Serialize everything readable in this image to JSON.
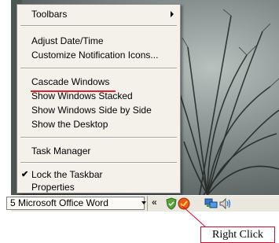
{
  "context_menu": {
    "items": [
      {
        "label": "Toolbars"
      },
      {
        "label": "Adjust Date/Time"
      },
      {
        "label": "Customize Notification Icons..."
      },
      {
        "label": "Cascade Windows"
      },
      {
        "label": "Show Windows Stacked"
      },
      {
        "label": "Show Windows Side by Side"
      },
      {
        "label": "Show the Desktop"
      },
      {
        "label": "Task Manager"
      },
      {
        "label": "Lock the Taskbar",
        "checked": true
      },
      {
        "label": "Properties"
      }
    ],
    "checkmark": "✔"
  },
  "taskbar": {
    "button_label": "5 Microsoft Office Word",
    "tray_chevron": "«"
  },
  "annotation": {
    "callout_label": "Right Click",
    "callout_color": "#c8102e",
    "underline_color": "#e0202a"
  },
  "icons": [
    "submenu-arrow-icon",
    "dropdown-arrow-icon",
    "shield-icon",
    "security-alert-icon",
    "network-icon",
    "speaker-icon",
    "check-icon"
  ]
}
